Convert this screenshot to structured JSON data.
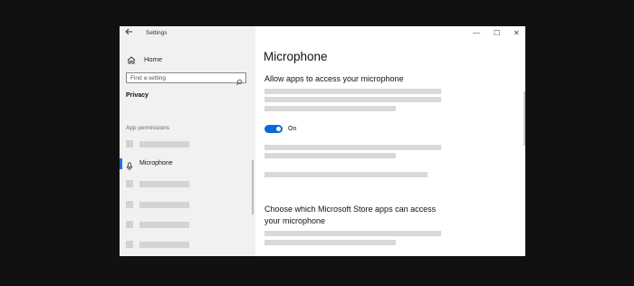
{
  "window": {
    "title": "Settings",
    "back_icon": "arrow-left-icon",
    "controls": {
      "minimize": "—",
      "maximize": "☐",
      "close": "✕"
    }
  },
  "sidebar": {
    "home_label": "Home",
    "home_icon": "home-icon",
    "search": {
      "placeholder": "Find a setting",
      "icon": "search-icon"
    },
    "section_title": "Privacy",
    "group_label": "App permissions",
    "active_item": {
      "label": "Microphone",
      "icon": "microphone-icon"
    },
    "accent": "#1a73d9"
  },
  "main": {
    "title": "Microphone",
    "section1_heading": "Allow apps to access your microphone",
    "toggle": {
      "state": "On",
      "on": true,
      "color": "#0a6ad9"
    },
    "section2_heading_line1": "Choose which Microsoft Store apps can access",
    "section2_heading_line2": "your microphone"
  }
}
